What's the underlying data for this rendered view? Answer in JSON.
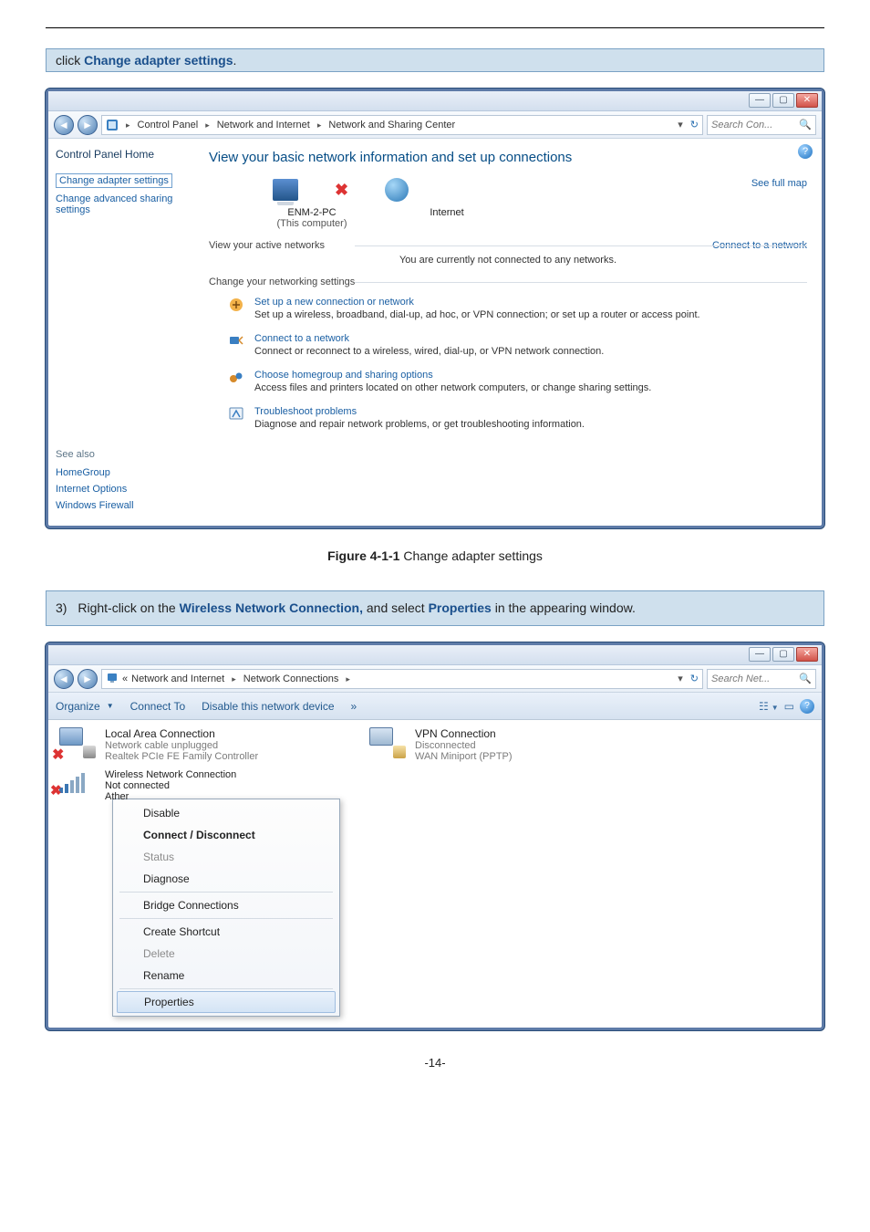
{
  "top_instruction_plain": "click ",
  "top_instruction_bold": "Change adapter settings",
  "figure1_caption_bold": "Figure 4-1-1",
  "figure1_caption_rest": " Change adapter settings",
  "step3_prefix": "3)",
  "step3_p1": "Right-click on the ",
  "step3_b1": "Wireless Network Connection,",
  "step3_p2": " and select ",
  "step3_b2": "Properties",
  "step3_p3": " in the appearing window.",
  "page_num": "-14-",
  "win1": {
    "breadcrumb": {
      "seg1": "Control Panel",
      "seg2": "Network and Internet",
      "seg3": "Network and Sharing Center"
    },
    "search_placeholder": "Search Con...",
    "sidebar": {
      "home": "Control Panel Home",
      "change_adapter": "Change adapter settings",
      "change_advanced": "Change advanced sharing settings",
      "see_also": "See also",
      "links": [
        "HomeGroup",
        "Internet Options",
        "Windows Firewall"
      ]
    },
    "heading": "View your basic network information and set up connections",
    "see_full_map": "See full map",
    "pc_name": "ENM-2-PC",
    "pc_sub": "(This computer)",
    "internet_label": "Internet",
    "active_networks_label": "View your active networks",
    "connect_network": "Connect to a network",
    "not_connected_msg": "You are currently not connected to any networks.",
    "change_settings_label": "Change your networking settings",
    "tasks": [
      {
        "title": "Set up a new connection or network",
        "desc": "Set up a wireless, broadband, dial-up, ad hoc, or VPN connection; or set up a router or access point."
      },
      {
        "title": "Connect to a network",
        "desc": "Connect or reconnect to a wireless, wired, dial-up, or VPN network connection."
      },
      {
        "title": "Choose homegroup and sharing options",
        "desc": "Access files and printers located on other network computers, or change sharing settings."
      },
      {
        "title": "Troubleshoot problems",
        "desc": "Diagnose and repair network problems, or get troubleshooting information."
      }
    ]
  },
  "win2": {
    "breadcrumb": {
      "prefix": "«",
      "seg1": "Network and Internet",
      "seg2": "Network Connections"
    },
    "search_placeholder": "Search Net...",
    "toolbar": {
      "organize": "Organize",
      "connect_to": "Connect To",
      "disable": "Disable this network device",
      "more": "»"
    },
    "lac": {
      "name": "Local Area Connection",
      "line2": "Network cable unplugged",
      "line3": "Realtek PCIe FE Family Controller"
    },
    "vpn": {
      "name": "VPN Connection",
      "line2": "Disconnected",
      "line3": "WAN Miniport (PPTP)"
    },
    "wlan": {
      "name": "Wireless Network Connection",
      "line2": "Not connected",
      "line3_prefix": "Ather"
    },
    "context_menu": [
      {
        "label": "Disable",
        "shield": true
      },
      {
        "label": "Connect / Disconnect",
        "bold": true
      },
      {
        "label": "Status",
        "gray": true
      },
      {
        "label": "Diagnose"
      },
      {
        "sep": true
      },
      {
        "label": "Bridge Connections",
        "shield": true
      },
      {
        "sep": true
      },
      {
        "label": "Create Shortcut"
      },
      {
        "label": "Delete",
        "gray": true,
        "shield": true
      },
      {
        "label": "Rename",
        "shield": true
      },
      {
        "sep": true
      },
      {
        "label": "Properties",
        "shield": true,
        "selected": true
      }
    ]
  }
}
